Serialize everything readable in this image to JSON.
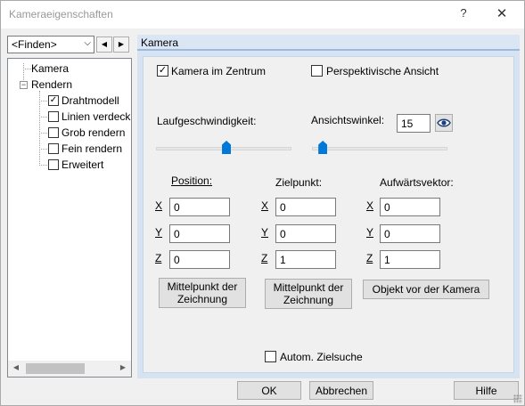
{
  "window": {
    "title": "Kameraeigenschaften",
    "help_glyph": "?",
    "close_glyph": "✕"
  },
  "finder": {
    "value": "<Finden>",
    "prev_glyph": "◀",
    "next_glyph": "▶"
  },
  "tree": {
    "root": "Kamera",
    "group": "Rendern",
    "group_expander": "−",
    "items": [
      {
        "label": "Drahtmodell",
        "checked": true
      },
      {
        "label": "Linien verdeck",
        "checked": false
      },
      {
        "label": "Grob rendern",
        "checked": false
      },
      {
        "label": "Fein rendern",
        "checked": false
      },
      {
        "label": "Erweitert",
        "checked": false
      }
    ],
    "scroll_left": "◀",
    "scroll_right": "▶"
  },
  "panel": {
    "header": "Kamera",
    "camera_center": {
      "label": "Kamera im Zentrum",
      "checked": true
    },
    "perspective": {
      "label": "Perspektivische Ansicht",
      "checked": false
    },
    "speed_label": "Laufgeschwindigkeit:",
    "angle_label": "Ansichtswinkel:",
    "angle_value": "15",
    "sliders": {
      "speed_fraction": 0.52,
      "angle_fraction": 0.08
    },
    "position": {
      "label": "Position:",
      "x": "0",
      "y": "0",
      "z": "0"
    },
    "target": {
      "label": "Zielpunkt:",
      "x": "0",
      "y": "0",
      "z": "1"
    },
    "up": {
      "label": "Aufwärtsvektor:",
      "x": "0",
      "y": "0",
      "z": "1"
    },
    "axis": {
      "x": "X",
      "y": "Y",
      "z": "Z"
    },
    "btn_center_1": "Mittelpunkt der\nZeichnung",
    "btn_center_2": "Mittelpunkt der\nZeichnung",
    "btn_object": "Objekt vor der Kamera",
    "auto_target": {
      "label": "Autom. Zielsuche",
      "checked": false
    }
  },
  "buttons": {
    "ok": "OK",
    "cancel": "Abbrechen",
    "help": "Hilfe"
  },
  "colors": {
    "accent": "#0078d7",
    "panel_header": "#dbe6f4",
    "panel_frame": "#d6e3f3"
  }
}
